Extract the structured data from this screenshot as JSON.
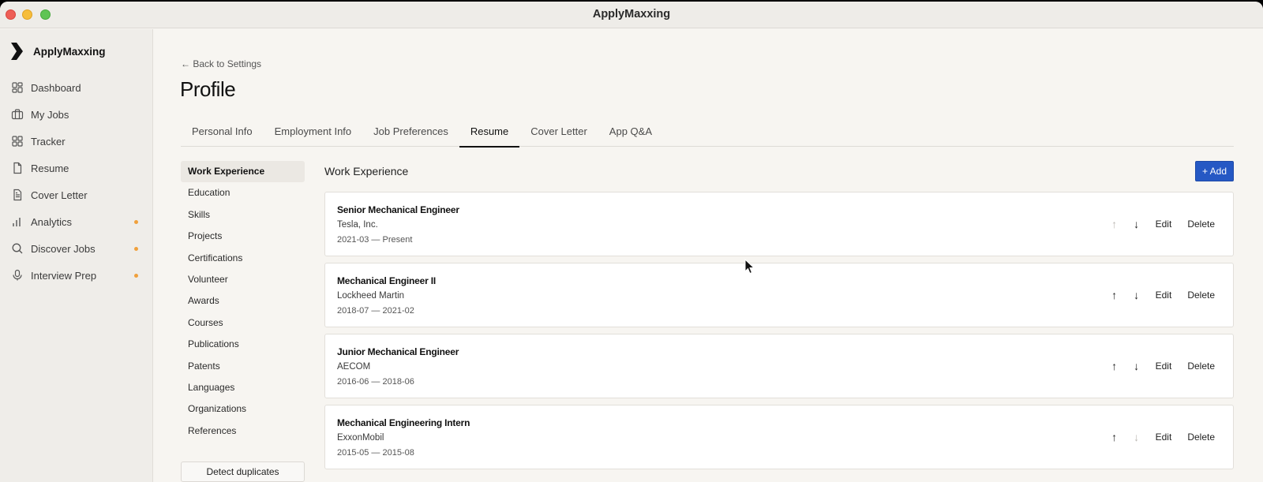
{
  "window": {
    "title": "ApplyMaxxing"
  },
  "sidebar": {
    "brand": "ApplyMaxxing",
    "items": [
      {
        "label": "Dashboard",
        "icon": "dashboard-icon",
        "dot": false
      },
      {
        "label": "My Jobs",
        "icon": "briefcase-icon",
        "dot": false
      },
      {
        "label": "Tracker",
        "icon": "grid-icon",
        "dot": false
      },
      {
        "label": "Resume",
        "icon": "document-icon",
        "dot": false
      },
      {
        "label": "Cover Letter",
        "icon": "letter-icon",
        "dot": false
      },
      {
        "label": "Analytics",
        "icon": "bar-chart-icon",
        "dot": true
      },
      {
        "label": "Discover Jobs",
        "icon": "search-icon",
        "dot": true
      },
      {
        "label": "Interview Prep",
        "icon": "microphone-icon",
        "dot": true
      }
    ]
  },
  "header": {
    "back_label": "← Back to Settings",
    "title": "Profile"
  },
  "tabs": [
    {
      "label": "Personal Info",
      "active": false
    },
    {
      "label": "Employment Info",
      "active": false
    },
    {
      "label": "Job Preferences",
      "active": false
    },
    {
      "label": "Resume",
      "active": true
    },
    {
      "label": "Cover Letter",
      "active": false
    },
    {
      "label": "App Q&A",
      "active": false
    }
  ],
  "sections": [
    "Work Experience",
    "Education",
    "Skills",
    "Projects",
    "Certifications",
    "Volunteer",
    "Awards",
    "Courses",
    "Publications",
    "Patents",
    "Languages",
    "Organizations",
    "References"
  ],
  "detect_duplicates_label": "Detect duplicates",
  "content": {
    "title": "Work Experience",
    "add_label": "+ Add",
    "edit_label": "Edit",
    "delete_label": "Delete",
    "up_glyph": "↑",
    "down_glyph": "↓",
    "entries": [
      {
        "title": "Senior Mechanical Engineer",
        "company": "Tesla, Inc.",
        "dates": "2021-03 — Present",
        "up_enabled": false,
        "down_enabled": true
      },
      {
        "title": "Mechanical Engineer II",
        "company": "Lockheed Martin",
        "dates": "2018-07 — 2021-02",
        "up_enabled": true,
        "down_enabled": true
      },
      {
        "title": "Junior Mechanical Engineer",
        "company": "AECOM",
        "dates": "2016-06 — 2018-06",
        "up_enabled": true,
        "down_enabled": true
      },
      {
        "title": "Mechanical Engineering Intern",
        "company": "ExxonMobil",
        "dates": "2015-05 — 2015-08",
        "up_enabled": true,
        "down_enabled": false
      }
    ]
  },
  "colors": {
    "accent": "#2558c4",
    "notification_dot": "#f0a03c"
  }
}
